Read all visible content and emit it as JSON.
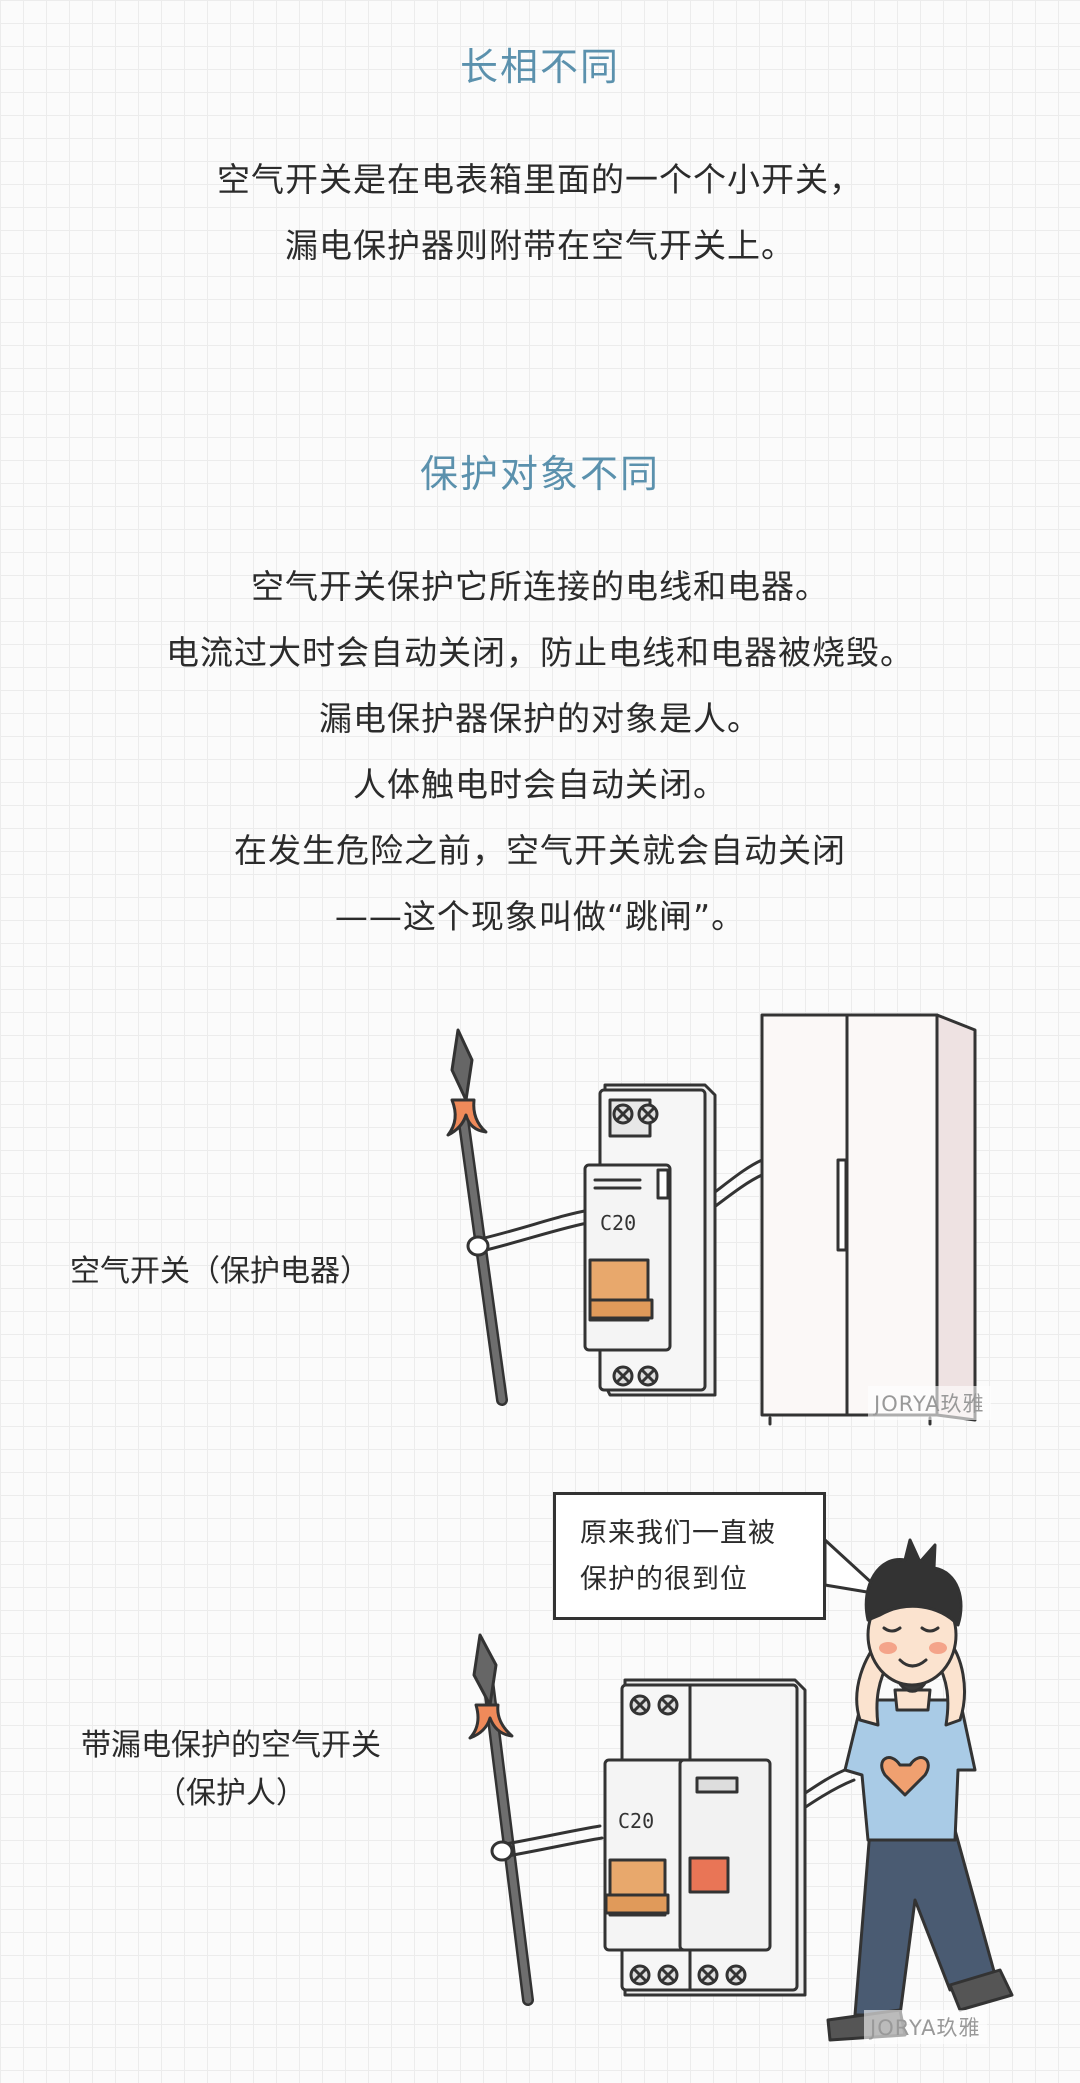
{
  "section1": {
    "heading": "长相不同",
    "lines": [
      "空气开关是在电表箱里面的一个个小开关，",
      "漏电保护器则附带在空气开关上。"
    ]
  },
  "section2": {
    "heading": "保护对象不同",
    "lines": [
      "空气开关保护它所连接的电线和电器。",
      "电流过大时会自动关闭，防止电线和电器被烧毁。",
      "漏电保护器保护的对象是人。",
      "人体触电时会自动关闭。",
      "在发生危险之前，空气开关就会自动关闭",
      "——这个现象叫做“跳闸”。"
    ]
  },
  "panel1": {
    "label": "空气开关（保护电器）",
    "breaker_rating": "C20",
    "watermark": "JORYA玖雅"
  },
  "panel2": {
    "label_line1": "带漏电保护的空气开关",
    "label_line2": "（保护人）",
    "bubble_line1": "原来我们一直被",
    "bubble_line2": "保护的很到位",
    "breaker_rating": "C20",
    "watermark": "JORYA玖雅"
  },
  "colors": {
    "heading": "#5b91ad",
    "switch_handle": "#e8a86c",
    "test_button": "#e97556",
    "shirt": "#a9cbe6",
    "heart": "#f0a070"
  }
}
